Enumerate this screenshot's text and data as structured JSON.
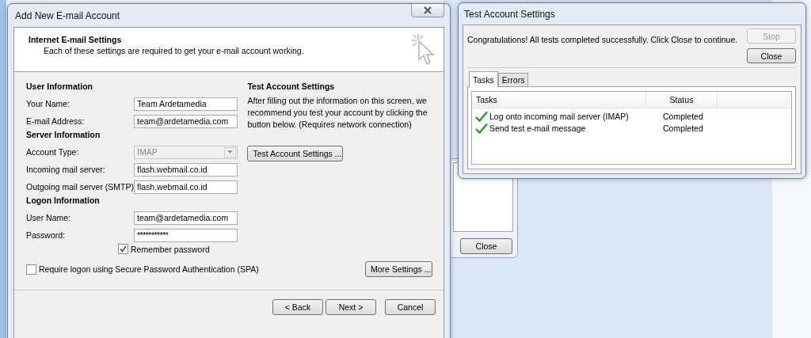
{
  "background_window": {
    "close_button": "Close"
  },
  "add_account_dialog": {
    "title": "Add New E-mail Account",
    "header": {
      "title": "Internet E-mail Settings",
      "subtitle": "Each of these settings are required to get your e-mail account working."
    },
    "sections": [
      {
        "heading": "User Information",
        "fields": [
          {
            "kind": "text",
            "label": "Your Name:",
            "value": "Team Ardetamedia",
            "disabled": false
          },
          {
            "kind": "text",
            "label": "E-mail Address:",
            "value": "team@ardetamedia.com",
            "disabled": false
          }
        ]
      },
      {
        "heading": "Server Information",
        "fields": [
          {
            "kind": "dropdown",
            "label": "Account Type:",
            "value": "IMAP",
            "disabled": true
          },
          {
            "kind": "text",
            "label": "Incoming mail server:",
            "value": "flash.webmail.co.id",
            "disabled": false
          },
          {
            "kind": "text",
            "label": "Outgoing mail server (SMTP):",
            "value": "flash.webmail.co.id",
            "disabled": false
          }
        ]
      },
      {
        "heading": "Logon Information",
        "fields": [
          {
            "kind": "text",
            "label": "User Name:",
            "value": "team@ardetamedia.com",
            "disabled": false
          },
          {
            "kind": "password",
            "label": "Password:",
            "value": "***********",
            "disabled": false
          }
        ]
      }
    ],
    "remember_password": {
      "label": "Remember password",
      "checked": true
    },
    "spa": {
      "label": "Require logon using Secure Password Authentication (SPA)",
      "checked": false
    },
    "test_settings": {
      "heading": "Test Account Settings",
      "description": "After filling out the information on this screen, we recommend you test your account by clicking the button below. (Requires network connection)",
      "button": "Test Account Settings ..."
    },
    "more_settings_button": "More Settings ...",
    "buttons": [
      "< Back",
      "Next >",
      "Cancel"
    ]
  },
  "test_dialog": {
    "title": "Test Account Settings",
    "message": "Congratulations! All tests completed successfully. Click Close to continue.",
    "buttons": [
      {
        "label": "Stop",
        "disabled": true
      },
      {
        "label": "Close",
        "disabled": false
      }
    ],
    "tabs": [
      {
        "label": "Tasks",
        "selected": true
      },
      {
        "label": "Errors",
        "selected": false
      }
    ],
    "columns": [
      "Tasks",
      "Status"
    ],
    "rows": [
      {
        "task": "Log onto incoming mail server (IMAP)",
        "status": "Completed",
        "done": true
      },
      {
        "task": "Send test e-mail message",
        "status": "Completed",
        "done": true
      }
    ]
  }
}
